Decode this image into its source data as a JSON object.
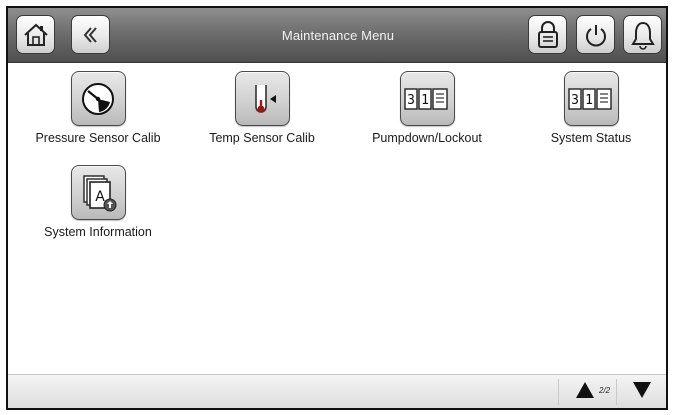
{
  "header": {
    "title": "Maintenance Menu",
    "buttons": {
      "home": "home-icon",
      "back": "back-icon",
      "lock": "lock-icon",
      "power": "power-icon",
      "alarm": "bell-icon"
    }
  },
  "menu": {
    "items": [
      {
        "label": "Pressure Sensor Calib",
        "icon": "gauge-icon"
      },
      {
        "label": "Temp Sensor Calib",
        "icon": "thermometer-icon"
      },
      {
        "label": "Pumpdown/Lockout",
        "icon": "calendar-icon"
      },
      {
        "label": "System Status",
        "icon": "calendar-icon"
      },
      {
        "label": "System Information",
        "icon": "info-documents-icon"
      }
    ],
    "calendar_digits": [
      "3",
      "1"
    ]
  },
  "footer": {
    "page_indicator": "2/2"
  }
}
